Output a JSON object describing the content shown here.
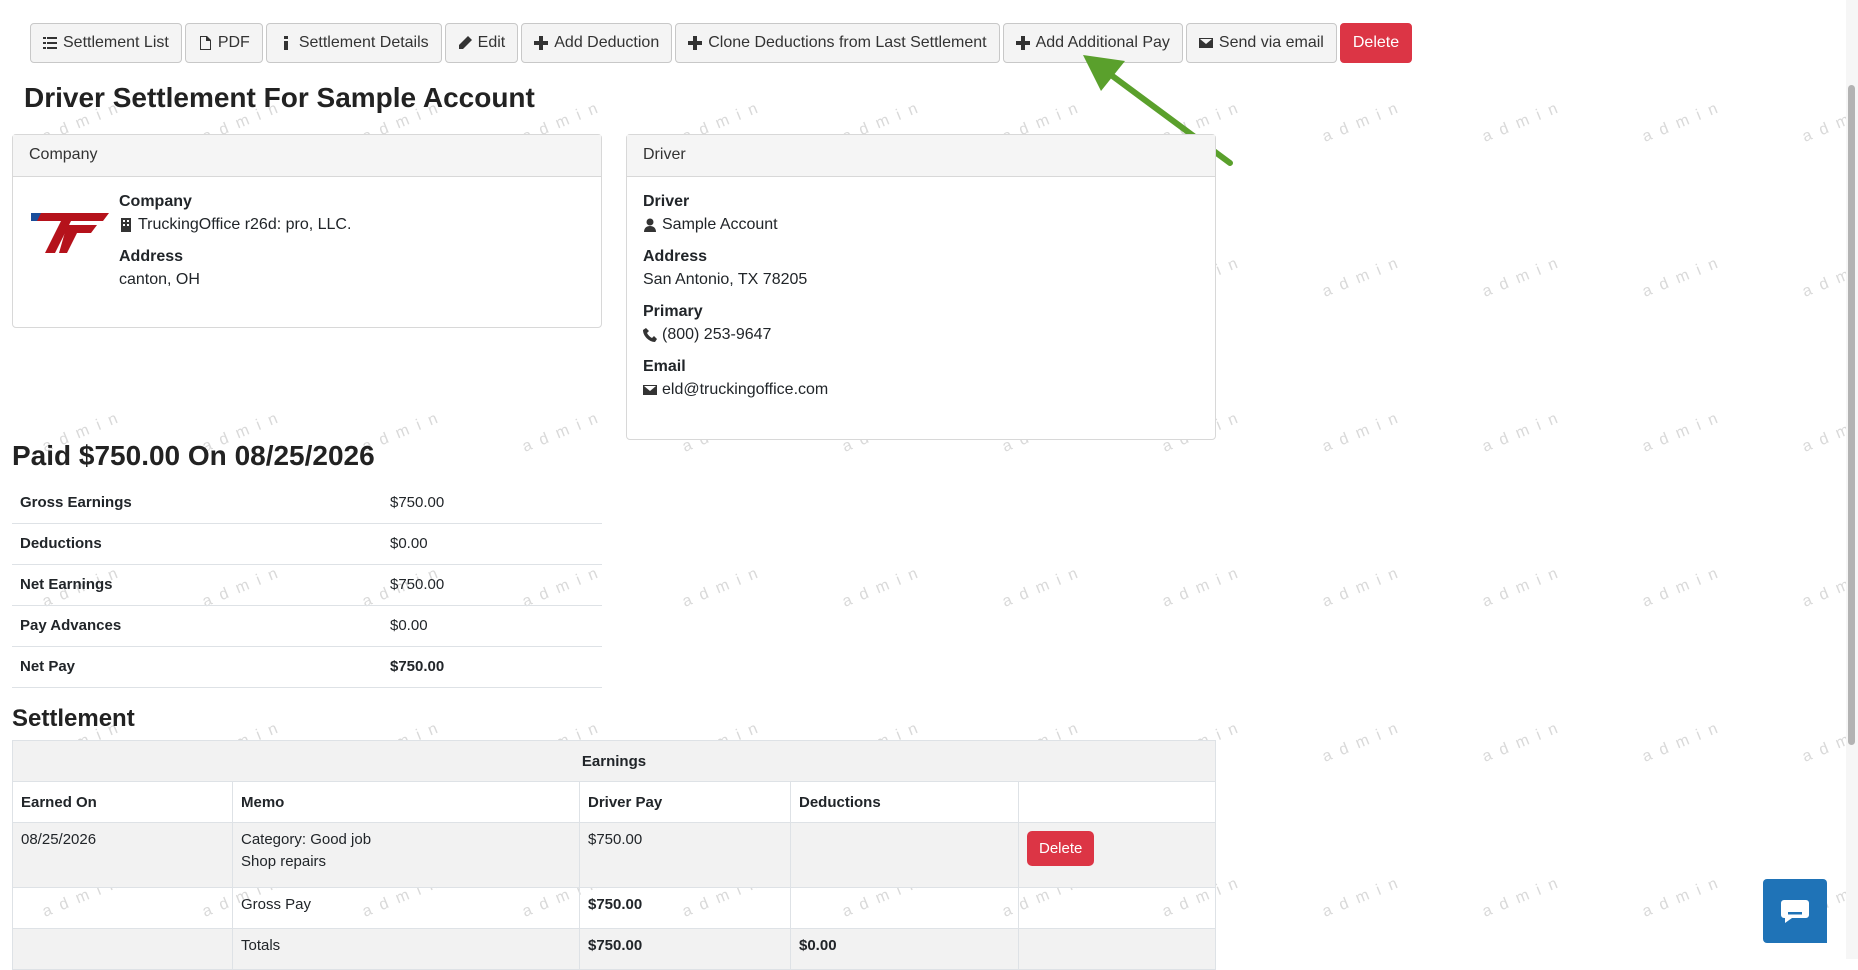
{
  "toolbar": {
    "settlement_list": "Settlement List",
    "pdf": "PDF",
    "settlement_details": "Settlement Details",
    "edit": "Edit",
    "add_deduction": "Add Deduction",
    "clone_deductions": "Clone Deductions from Last Settlement",
    "add_additional_pay": "Add Additional Pay",
    "send_via_email": "Send via email",
    "delete": "Delete"
  },
  "page_title": "Driver Settlement For Sample Account",
  "watermark_text": "admin",
  "company_card": {
    "header": "Company",
    "company_label": "Company",
    "company_name": "TruckingOffice r26d: pro, LLC.",
    "address_label": "Address",
    "address": "canton, OH"
  },
  "driver_card": {
    "header": "Driver",
    "driver_label": "Driver",
    "driver_name": "Sample Account",
    "address_label": "Address",
    "address": "San Antonio, TX 78205",
    "primary_label": "Primary",
    "phone": "(800) 253-9647",
    "email_label": "Email",
    "email": "eld@truckingoffice.com"
  },
  "paid_heading": "Paid $750.00 On 08/25/2026",
  "summary": [
    {
      "label": "Gross Earnings",
      "value": "$750.00"
    },
    {
      "label": "Deductions",
      "value": "$0.00"
    },
    {
      "label": "Net Earnings",
      "value": "$750.00"
    },
    {
      "label": "Pay Advances",
      "value": "$0.00"
    },
    {
      "label": "Net Pay",
      "value": "$750.00"
    }
  ],
  "settlement_heading": "Settlement",
  "earnings_table": {
    "group_header": "Earnings",
    "columns": [
      "Earned On",
      "Memo",
      "Driver Pay",
      "Deductions",
      ""
    ],
    "row": {
      "earned_on": "08/25/2026",
      "memo_line1": "Category: Good job",
      "memo_line2": "Shop repairs",
      "driver_pay": "$750.00",
      "deductions": "",
      "delete_label": "Delete"
    },
    "gross_pay": {
      "label": "Gross Pay",
      "value": "$750.00"
    },
    "totals": {
      "label": "Totals",
      "driver_pay": "$750.00",
      "deductions": "$0.00"
    }
  },
  "colors": {
    "danger": "#dc3545",
    "chat": "#1f73b7",
    "arrow": "#5aa02c"
  }
}
